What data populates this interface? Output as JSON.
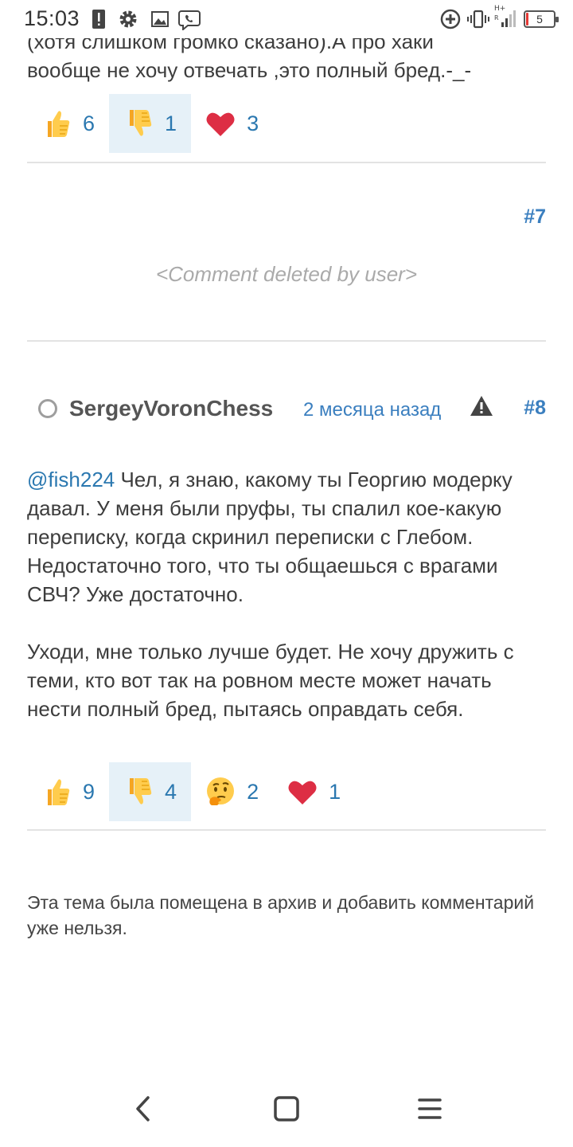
{
  "status_bar": {
    "time": "15:03",
    "battery_level": "5",
    "icons": [
      "alert-icon",
      "gear-icon",
      "image-icon",
      "viber-icon",
      "data-saver-icon",
      "vibrate-icon",
      "signal-icon",
      "battery-icon"
    ]
  },
  "previous_comment": {
    "text_line1": "(хотя слишком громко сказано).А про хаки",
    "text_line2": "вообще не хочу отвечать ,это полный бред.-_-",
    "reactions": [
      {
        "icon": "thumbs-up-icon",
        "count": "6"
      },
      {
        "icon": "thumbs-down-icon",
        "count": "1",
        "active": true
      },
      {
        "icon": "heart-icon",
        "count": "3"
      }
    ]
  },
  "deleted_comment": {
    "number": "#7",
    "text": "<Comment deleted by user>"
  },
  "comment": {
    "username": "SergeyVoronChess",
    "time_ago": "2 месяца назад",
    "number": "#8",
    "mention": "@fish224",
    "paragraph1": "Чел, я знаю, какому ты Георгию модерку давал. У меня были пруфы, ты спалил кое-какую переписку, когда скринил переписки с Глебом. Недостаточно того, что ты общаешься с врагами СВЧ? Уже достаточно.",
    "paragraph2": "Уходи, мне только лучше будет. Не хочу дружить с теми, кто вот так на ровном месте может начать нести полный бред, пытаясь оправдать себя.",
    "reactions": [
      {
        "icon": "thumbs-up-icon",
        "count": "9"
      },
      {
        "icon": "thumbs-down-icon",
        "count": "4",
        "active": true
      },
      {
        "icon": "thinking-face-icon",
        "count": "2"
      },
      {
        "icon": "heart-icon",
        "count": "1"
      }
    ]
  },
  "archived_notice": "Эта тема была помещена в архив и добавить комментарий уже нельзя.",
  "nav_bar": {
    "icons": [
      "back-icon",
      "home-icon",
      "menu-icon"
    ]
  },
  "colors": {
    "link": "#2b78b0",
    "post_number": "#3b7fbf",
    "active_reaction_bg": "#e6f1f8",
    "deleted_text": "#aaaaaa",
    "battery_low": "#e53935"
  }
}
